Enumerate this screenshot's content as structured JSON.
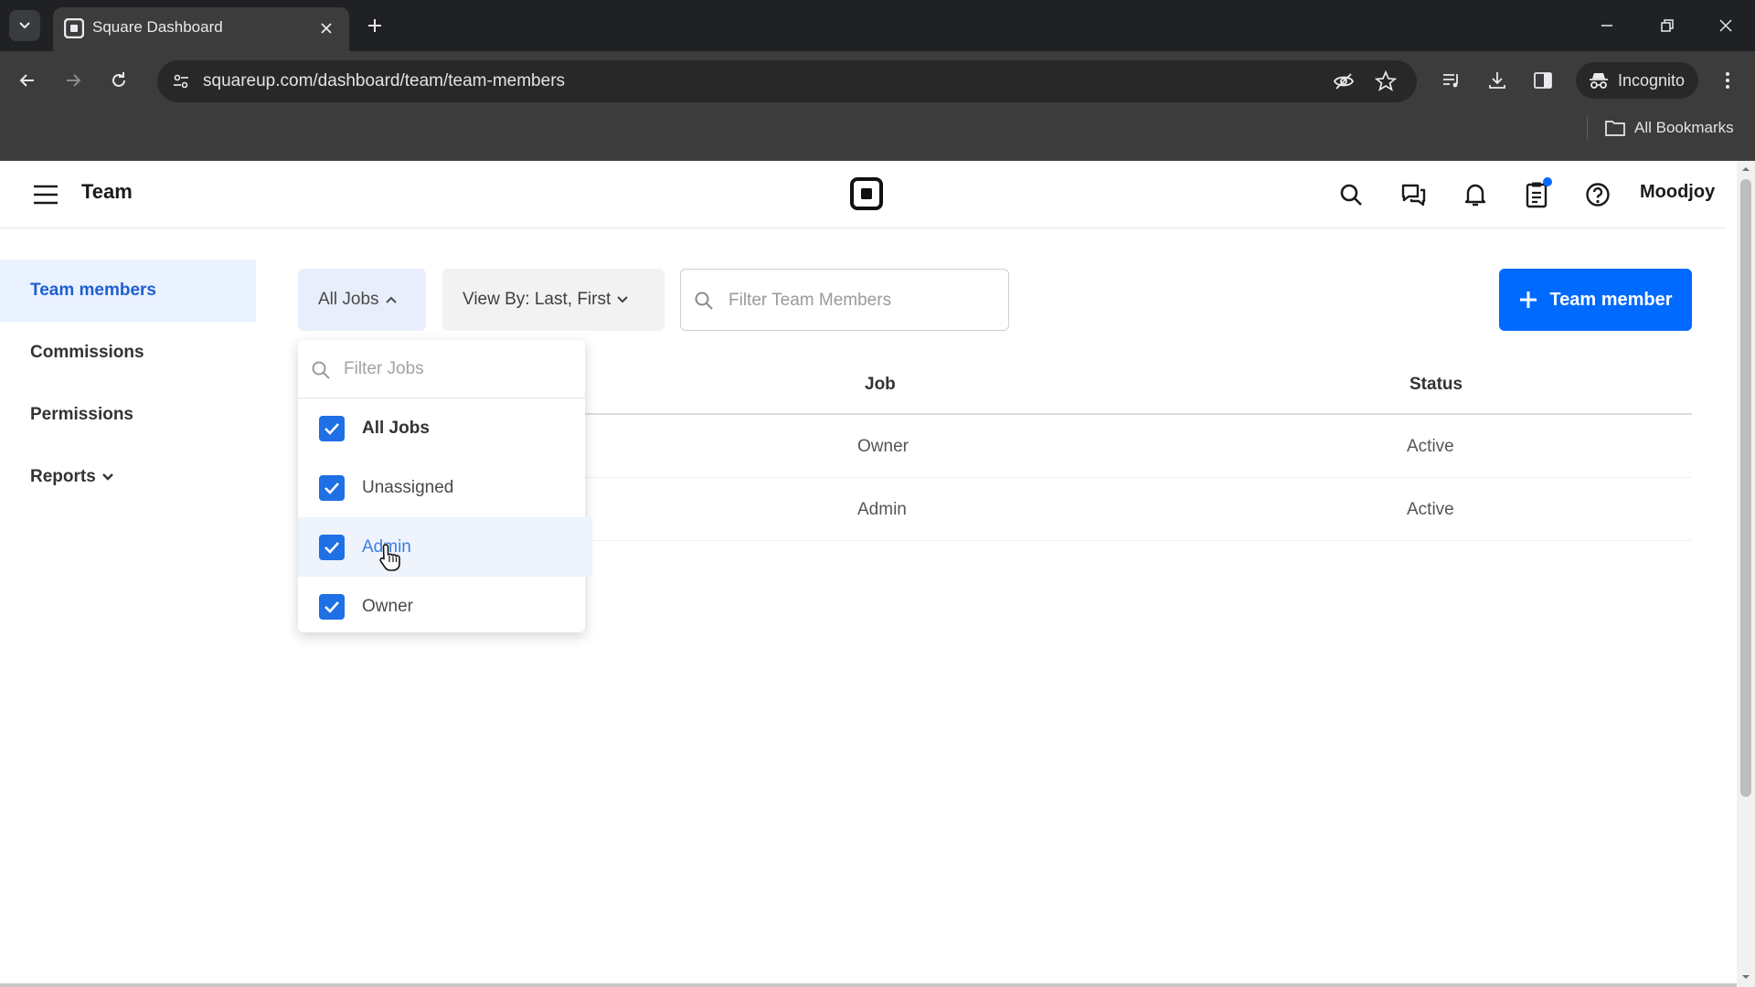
{
  "browser": {
    "tab_title": "Square Dashboard",
    "url": "squareup.com/dashboard/team/team-members",
    "incognito_label": "Incognito",
    "bookmarks_label": "All Bookmarks"
  },
  "header": {
    "title": "Team",
    "account_name": "Moodjoy",
    "icons": [
      "search-icon",
      "messages-icon",
      "bell-icon",
      "clipboard-icon",
      "help-icon"
    ]
  },
  "sidebar": {
    "items": [
      {
        "label": "Team members",
        "active": true
      },
      {
        "label": "Commissions"
      },
      {
        "label": "Permissions"
      },
      {
        "label": "Reports"
      }
    ]
  },
  "toolbar": {
    "jobs_filter_label": "All Jobs",
    "view_by_label": "View By: Last, First",
    "search_placeholder": "Filter Team Members",
    "add_button_label": "Team member"
  },
  "table": {
    "columns": [
      "Job",
      "Status"
    ],
    "rows": [
      {
        "job": "Owner",
        "status": "Active"
      },
      {
        "job": "Admin",
        "status": "Active"
      }
    ]
  },
  "jobs_dropdown": {
    "search_placeholder": "Filter Jobs",
    "options": [
      {
        "label": "All Jobs",
        "checked": true
      },
      {
        "label": "Unassigned",
        "checked": true
      },
      {
        "label": "Admin",
        "checked": true
      },
      {
        "label": "Owner",
        "checked": true
      }
    ]
  },
  "colors": {
    "accent": "#006aff",
    "checkbox": "#1f6fe5",
    "active_nav_bg": "#eaf2ff",
    "notification_dot": "#006aff"
  }
}
